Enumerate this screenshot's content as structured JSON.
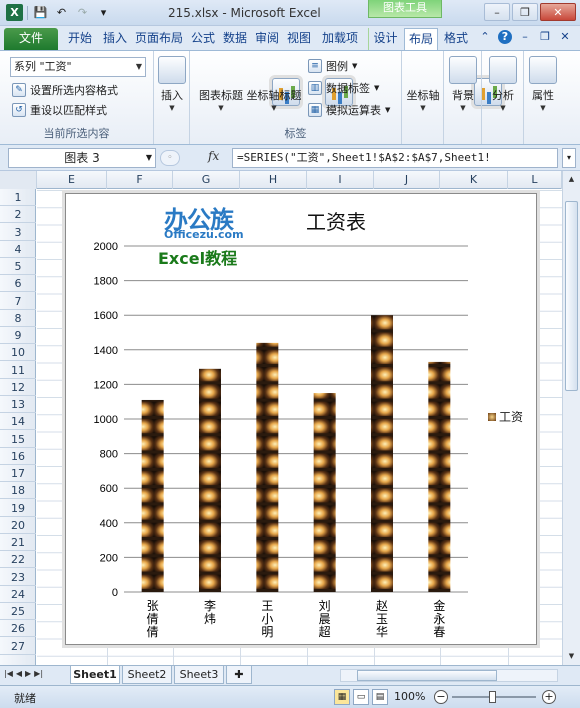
{
  "window": {
    "title": "215.xlsx - Microsoft Excel",
    "context_tab_group": "图表工具"
  },
  "tabs": [
    "文件",
    "开始",
    "插入",
    "页面布局",
    "公式",
    "数据",
    "审阅",
    "视图",
    "加载项",
    "设计",
    "布局",
    "格式"
  ],
  "active_tab": "布局",
  "ribbon": {
    "selection_dropdown": "系列 \"工资\"",
    "format_selection": "设置所选内容格式",
    "reset_style": "重设以匹配样式",
    "group_current": "当前所选内容",
    "insert": "插入",
    "chart_title": "图表标题",
    "axis_titles": "坐标轴标题",
    "legend": "图例",
    "data_labels": "数据标签",
    "data_table": "模拟运算表",
    "group_labels": "标签",
    "axes": "坐标轴",
    "background": "背景",
    "analysis": "分析",
    "properties": "属性"
  },
  "formula_bar": {
    "name_box": "图表 3",
    "fx": "fx",
    "formula": "=SERIES(\"工资\",Sheet1!$A$2:$A$7,Sheet1!"
  },
  "columns": [
    "E",
    "F",
    "G",
    "H",
    "I",
    "J",
    "K",
    "L"
  ],
  "rows": [
    "1",
    "2",
    "3",
    "4",
    "5",
    "6",
    "7",
    "8",
    "9",
    "10",
    "11",
    "12",
    "13",
    "14",
    "15",
    "16",
    "17",
    "18",
    "19",
    "20",
    "21",
    "22",
    "23",
    "24",
    "25",
    "26",
    "27"
  ],
  "watermark": {
    "brand": "办公族",
    "site": "Officezu.com",
    "tag": "Excel教程"
  },
  "chart_data": {
    "type": "bar",
    "title": "工资表",
    "categories": [
      "张倩倩",
      "李炜",
      "王小明",
      "刘晨超",
      "赵玉华",
      "金永春"
    ],
    "series": [
      {
        "name": "工资",
        "values": [
          1110,
          1290,
          1440,
          1150,
          1600,
          1330
        ]
      }
    ],
    "ylim": [
      0,
      2000
    ],
    "yticks": [
      0,
      200,
      400,
      600,
      800,
      1000,
      1200,
      1400,
      1600,
      1800,
      2000
    ],
    "grid": true,
    "legend": "right",
    "fill": "picture-stack"
  },
  "sheets": [
    "Sheet1",
    "Sheet2",
    "Sheet3"
  ],
  "active_sheet": "Sheet1",
  "status": {
    "ready": "就绪",
    "zoom": "100%"
  },
  "colors": {
    "accent": "#15428b",
    "file_tab": "#1e7a2e",
    "context_tab": "#7fd37a"
  }
}
